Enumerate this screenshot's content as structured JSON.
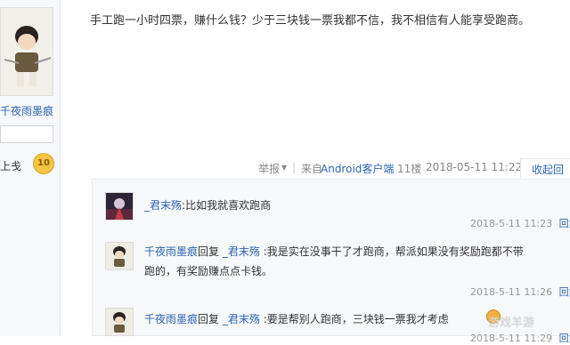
{
  "sidebar": {
    "username": "千夜雨墨痕",
    "level_label": "上戋",
    "level_value": "10"
  },
  "post": {
    "content": "手工跑一小时四票，赚什么钱？少于三块钱一票我都不信，我不相信有人能享受跑商。",
    "report": "举报",
    "report_arrow": "▼",
    "source_prefix": "来自",
    "source_link": "Android客户端",
    "floor": "11楼",
    "time": "2018-05-11 11:22",
    "collapse": "收起回复"
  },
  "replies": [
    {
      "user": "_君末殇",
      "sep": ":",
      "text": "比如我就喜欢跑商",
      "time": "2018-5-11 11:23",
      "reply_label": "回复"
    },
    {
      "user": "千夜雨墨痕",
      "reply_word": "回复",
      "target": "_君末殇",
      "sep": ":",
      "text": "我是实在没事干了才跑商，帮派如果没有奖励跑都不带",
      "text2": "跑的，有奖励赚点点卡钱。",
      "time": "2018-5-11 11:26",
      "reply_label": "回复"
    },
    {
      "user": "千夜雨墨痕",
      "reply_word": "回复",
      "target": "_君末殇",
      "sep": ":",
      "text": "要是帮别人跑商，三块钱一票我才考虑",
      "time": "2018-5-11 11:29",
      "reply_label": "回复"
    }
  ],
  "watermark": "游戏羊游"
}
